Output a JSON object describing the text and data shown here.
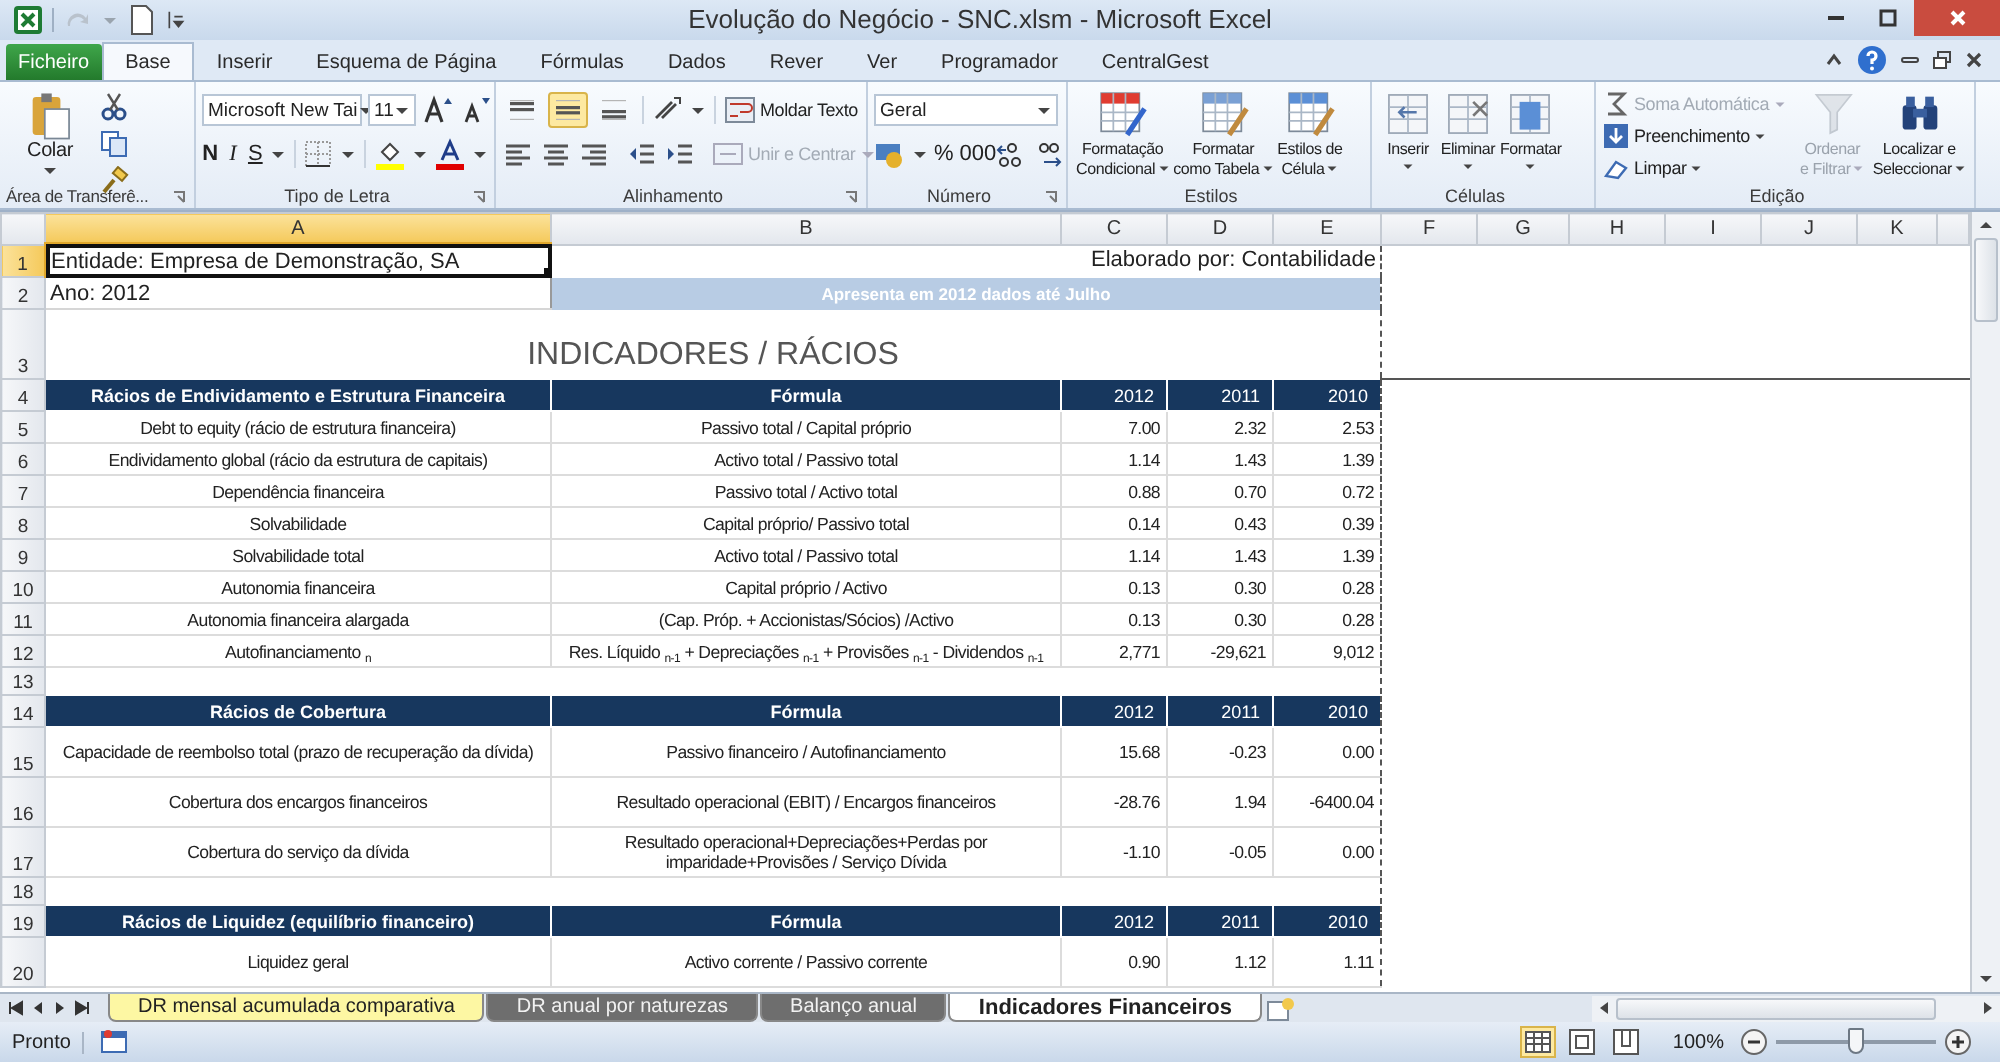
{
  "window": {
    "title": "Evolução do Negócio - SNC.xlsm - Microsoft Excel"
  },
  "ribbon_tabs": [
    {
      "label": "Ficheiro",
      "kind": "file",
      "selected": false
    },
    {
      "label": "Base",
      "kind": "tab",
      "selected": true
    },
    {
      "label": "Inserir",
      "kind": "tab",
      "selected": false
    },
    {
      "label": "Esquema de Página",
      "kind": "tab",
      "selected": false
    },
    {
      "label": "Fórmulas",
      "kind": "tab",
      "selected": false
    },
    {
      "label": "Dados",
      "kind": "tab",
      "selected": false
    },
    {
      "label": "Rever",
      "kind": "tab",
      "selected": false
    },
    {
      "label": "Ver",
      "kind": "tab",
      "selected": false
    },
    {
      "label": "Programador",
      "kind": "tab",
      "selected": false
    },
    {
      "label": "CentralGest",
      "kind": "tab",
      "selected": false
    }
  ],
  "ribbon": {
    "clipboard": {
      "label": "Área de Transferê...",
      "paste": "Colar"
    },
    "font": {
      "label": "Tipo de Letra",
      "font_name": "Microsoft New Tai",
      "font_size": "11",
      "bold": "N",
      "italic": "I",
      "underline": "S"
    },
    "alignment": {
      "label": "Alinhamento",
      "vertical": [
        {
          "selected": false
        },
        {
          "selected": true
        },
        {
          "selected": false
        }
      ],
      "wrap": "Moldar Texto",
      "merge": "Unir e Centrar"
    },
    "number": {
      "label": "Número",
      "format": "Geral",
      "percent": "%",
      "thousands": "000"
    },
    "styles": {
      "label": "Estilos",
      "buttons": [
        {
          "lines": [
            "Formatação",
            "Condicional"
          ]
        },
        {
          "lines": [
            "Formatar",
            "como Tabela"
          ]
        },
        {
          "lines": [
            "Estilos de",
            "Célula"
          ]
        }
      ]
    },
    "cells": {
      "label": "Células",
      "buttons": [
        {
          "label": "Inserir"
        },
        {
          "label": "Eliminar"
        },
        {
          "label": "Formatar"
        }
      ]
    },
    "editing": {
      "label": "Edição",
      "small_buttons": [
        {
          "label": "Soma Automática",
          "disabled": true
        },
        {
          "label": "Preenchimento",
          "disabled": false
        },
        {
          "label": "Limpar",
          "disabled": false
        }
      ],
      "big_buttons": [
        {
          "lines": [
            "Ordenar",
            "e Filtrar"
          ],
          "disabled": true
        },
        {
          "lines": [
            "Localizar e",
            "Seleccionar"
          ],
          "disabled": false
        }
      ]
    }
  },
  "sheet": {
    "columns": [
      {
        "label": "A",
        "selected": true
      },
      {
        "label": "B",
        "selected": false
      },
      {
        "label": "C",
        "selected": false
      },
      {
        "label": "D",
        "selected": false
      },
      {
        "label": "E",
        "selected": false
      },
      {
        "label": "F",
        "selected": false
      },
      {
        "label": "G",
        "selected": false
      },
      {
        "label": "H",
        "selected": false
      },
      {
        "label": "I",
        "selected": false
      },
      {
        "label": "J",
        "selected": false
      },
      {
        "label": "K",
        "selected": false
      }
    ],
    "rows": [
      {
        "number": "1",
        "selected": true,
        "kind": "info",
        "cells": {
          "A": "Entidade: Empresa de Demonstração, SA",
          "E": "Elaborado por: Contabilidade"
        }
      },
      {
        "number": "2",
        "selected": false,
        "kind": "band",
        "cells": {
          "A": "Ano: 2012",
          "B": "Apresenta em 2012 dados até Julho"
        }
      },
      {
        "number": "3",
        "selected": false,
        "kind": "title",
        "cells": {
          "A": "INDICADORES / RÁCIOS"
        }
      },
      {
        "number": "4",
        "selected": false,
        "kind": "header",
        "cells": [
          "Rácios de Endividamento e Estrutura Financeira",
          "Fórmula",
          "2012",
          "2011",
          "2010"
        ]
      },
      {
        "number": "5",
        "selected": false,
        "kind": "data",
        "cells": [
          "Debt to equity (rácio de estrutura financeira)",
          "Passivo total / Capital próprio",
          "7.00",
          "2.32",
          "2.53"
        ]
      },
      {
        "number": "6",
        "selected": false,
        "kind": "data",
        "cells": [
          "Endividamento global (rácio da estrutura de capitais)",
          "Activo total / Passivo total",
          "1.14",
          "1.43",
          "1.39"
        ]
      },
      {
        "number": "7",
        "selected": false,
        "kind": "data",
        "cells": [
          "Dependência financeira",
          "Passivo total / Activo total",
          "0.88",
          "0.70",
          "0.72"
        ]
      },
      {
        "number": "8",
        "selected": false,
        "kind": "data",
        "cells": [
          "Solvabilidade",
          "Capital próprio/ Passivo total",
          "0.14",
          "0.43",
          "0.39"
        ]
      },
      {
        "number": "9",
        "selected": false,
        "kind": "data",
        "cells": [
          "Solvabilidade total",
          "Activo total / Passivo total",
          "1.14",
          "1.43",
          "1.39"
        ]
      },
      {
        "number": "10",
        "selected": false,
        "kind": "data",
        "cells": [
          "Autonomia financeira",
          "Capital próprio / Activo",
          "0.13",
          "0.30",
          "0.28"
        ]
      },
      {
        "number": "11",
        "selected": false,
        "kind": "data",
        "cells": [
          "Autonomia financeira alargada",
          "(Cap. Próp. + Accionistas/Sócios) /Activo",
          "0.13",
          "0.30",
          "0.28"
        ]
      },
      {
        "number": "12",
        "selected": false,
        "kind": "data",
        "cells": [
          "Autofinanciamento $_{n}$",
          "Res. Líquido $_{n-1}$ + Depreciações $_{n-1}$ + Provisões $_{n-1}$ - Dividendos $_{n-1}$",
          "2,771",
          "-29,621",
          "9,012"
        ]
      },
      {
        "number": "13",
        "selected": false,
        "kind": "blank",
        "cells": []
      },
      {
        "number": "14",
        "selected": false,
        "kind": "header",
        "cells": [
          "Rácios de Cobertura",
          "Fórmula",
          "2012",
          "2011",
          "2010"
        ]
      },
      {
        "number": "15",
        "selected": false,
        "kind": "tall",
        "cells": [
          "Capacidade de reembolso total (prazo de recuperação da dívida)",
          "Passivo financeiro / Autofinanciamento",
          "15.68",
          "-0.23",
          "0.00"
        ]
      },
      {
        "number": "16",
        "selected": false,
        "kind": "tall",
        "cells": [
          "Cobertura dos encargos financeiros",
          "Resultado operacional (EBIT) / Encargos financeiros",
          "-28.76",
          "1.94",
          "-6400.04"
        ]
      },
      {
        "number": "17",
        "selected": false,
        "kind": "tall",
        "cells": [
          "Cobertura do serviço da dívida",
          "Resultado operacional+Depreciações+Perdas por imparidade+Provisões / Serviço Dívida",
          "-1.10",
          "-0.05",
          "0.00"
        ]
      },
      {
        "number": "18",
        "selected": false,
        "kind": "blank",
        "cells": []
      },
      {
        "number": "19",
        "selected": false,
        "kind": "header",
        "cells": [
          "Rácios de Liquidez (equilíbrio financeiro)",
          "Fórmula",
          "2012",
          "2011",
          "2010"
        ]
      },
      {
        "number": "20",
        "selected": false,
        "kind": "tall",
        "cells": [
          "Liquidez geral",
          "Activo corrente / Passivo corrente",
          "0.90",
          "1.12",
          "1.11"
        ]
      }
    ]
  },
  "sheet_tabs": [
    {
      "label": "DR mensal acumulada comparativa",
      "selected": false,
      "color": "#fdf7a3"
    },
    {
      "label": "DR anual por naturezas",
      "selected": false,
      "color": "#6e6e6e"
    },
    {
      "label": "Balanço anual",
      "selected": false,
      "color": "#6e6e6e"
    },
    {
      "label": "Indicadores Financeiros",
      "selected": true,
      "color": "#ffffff"
    }
  ],
  "status_bar": {
    "mode": "Pronto",
    "views": [
      {
        "selected": true
      },
      {
        "selected": false
      },
      {
        "selected": false
      }
    ],
    "zoom": "100%",
    "zoom_slider": {
      "level": 0.5
    }
  }
}
